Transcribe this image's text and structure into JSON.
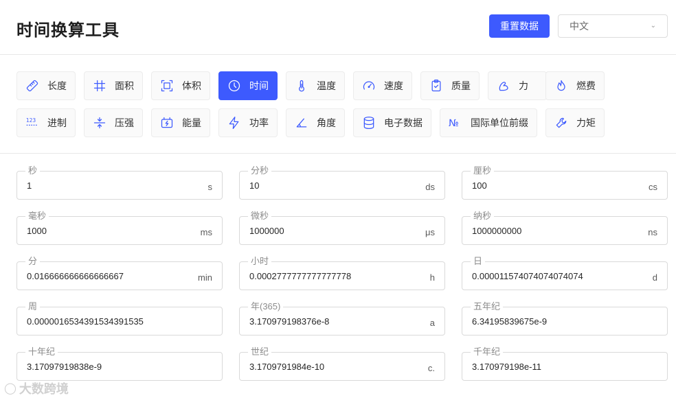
{
  "header": {
    "title": "时间换算工具",
    "reset_label": "重置数据",
    "language": "中文"
  },
  "colors": {
    "accent": "#3d5afe"
  },
  "categories": [
    {
      "label": "长度",
      "icon": "ruler-icon",
      "active": false
    },
    {
      "label": "面积",
      "icon": "hash-icon",
      "active": false
    },
    {
      "label": "体积",
      "icon": "frame-icon",
      "active": false
    },
    {
      "label": "时间",
      "icon": "clock-icon",
      "active": true
    },
    {
      "label": "温度",
      "icon": "thermometer-icon",
      "active": false
    },
    {
      "label": "速度",
      "icon": "gauge-icon",
      "active": false
    },
    {
      "label": "质量",
      "icon": "clipboard-icon",
      "active": false
    },
    {
      "label": "力",
      "icon": "arm-icon",
      "active": false
    },
    {
      "label": "燃费",
      "icon": "flame-icon",
      "active": false
    },
    {
      "label": "进制",
      "icon": "numbers-icon",
      "active": false
    },
    {
      "label": "压强",
      "icon": "compress-icon",
      "active": false
    },
    {
      "label": "能量",
      "icon": "battery-icon",
      "active": false
    },
    {
      "label": "功率",
      "icon": "bolt-icon",
      "active": false
    },
    {
      "label": "角度",
      "icon": "angle-icon",
      "active": false
    },
    {
      "label": "电子数据",
      "icon": "database-icon",
      "active": false
    },
    {
      "label": "国际单位前缀",
      "icon": "numero-icon",
      "active": false
    },
    {
      "label": "力矩",
      "icon": "wrench-icon",
      "active": false
    }
  ],
  "fields": [
    {
      "label": "秒",
      "value": "1",
      "unit": "s"
    },
    {
      "label": "分秒",
      "value": "10",
      "unit": "ds"
    },
    {
      "label": "厘秒",
      "value": "100",
      "unit": "cs"
    },
    {
      "label": "毫秒",
      "value": "1000",
      "unit": "ms"
    },
    {
      "label": "微秒",
      "value": "1000000",
      "unit": "μs"
    },
    {
      "label": "纳秒",
      "value": "1000000000",
      "unit": "ns"
    },
    {
      "label": "分",
      "value": "0.016666666666666667",
      "unit": "min"
    },
    {
      "label": "小时",
      "value": "0.0002777777777777778",
      "unit": "h"
    },
    {
      "label": "日",
      "value": "0.000011574074074074074",
      "unit": "d"
    },
    {
      "label": "周",
      "value": "0.0000016534391534391535",
      "unit": ""
    },
    {
      "label": "年(365)",
      "value": "3.170979198376e-8",
      "unit": "a"
    },
    {
      "label": "五年纪",
      "value": "6.34195839675e-9",
      "unit": ""
    },
    {
      "label": "十年纪",
      "value": "3.17097919838e-9",
      "unit": ""
    },
    {
      "label": "世纪",
      "value": "3.1709791984e-10",
      "unit": "c."
    },
    {
      "label": "千年纪",
      "value": "3.170979198e-11",
      "unit": ""
    }
  ],
  "watermark": {
    "text": "大数跨境"
  }
}
